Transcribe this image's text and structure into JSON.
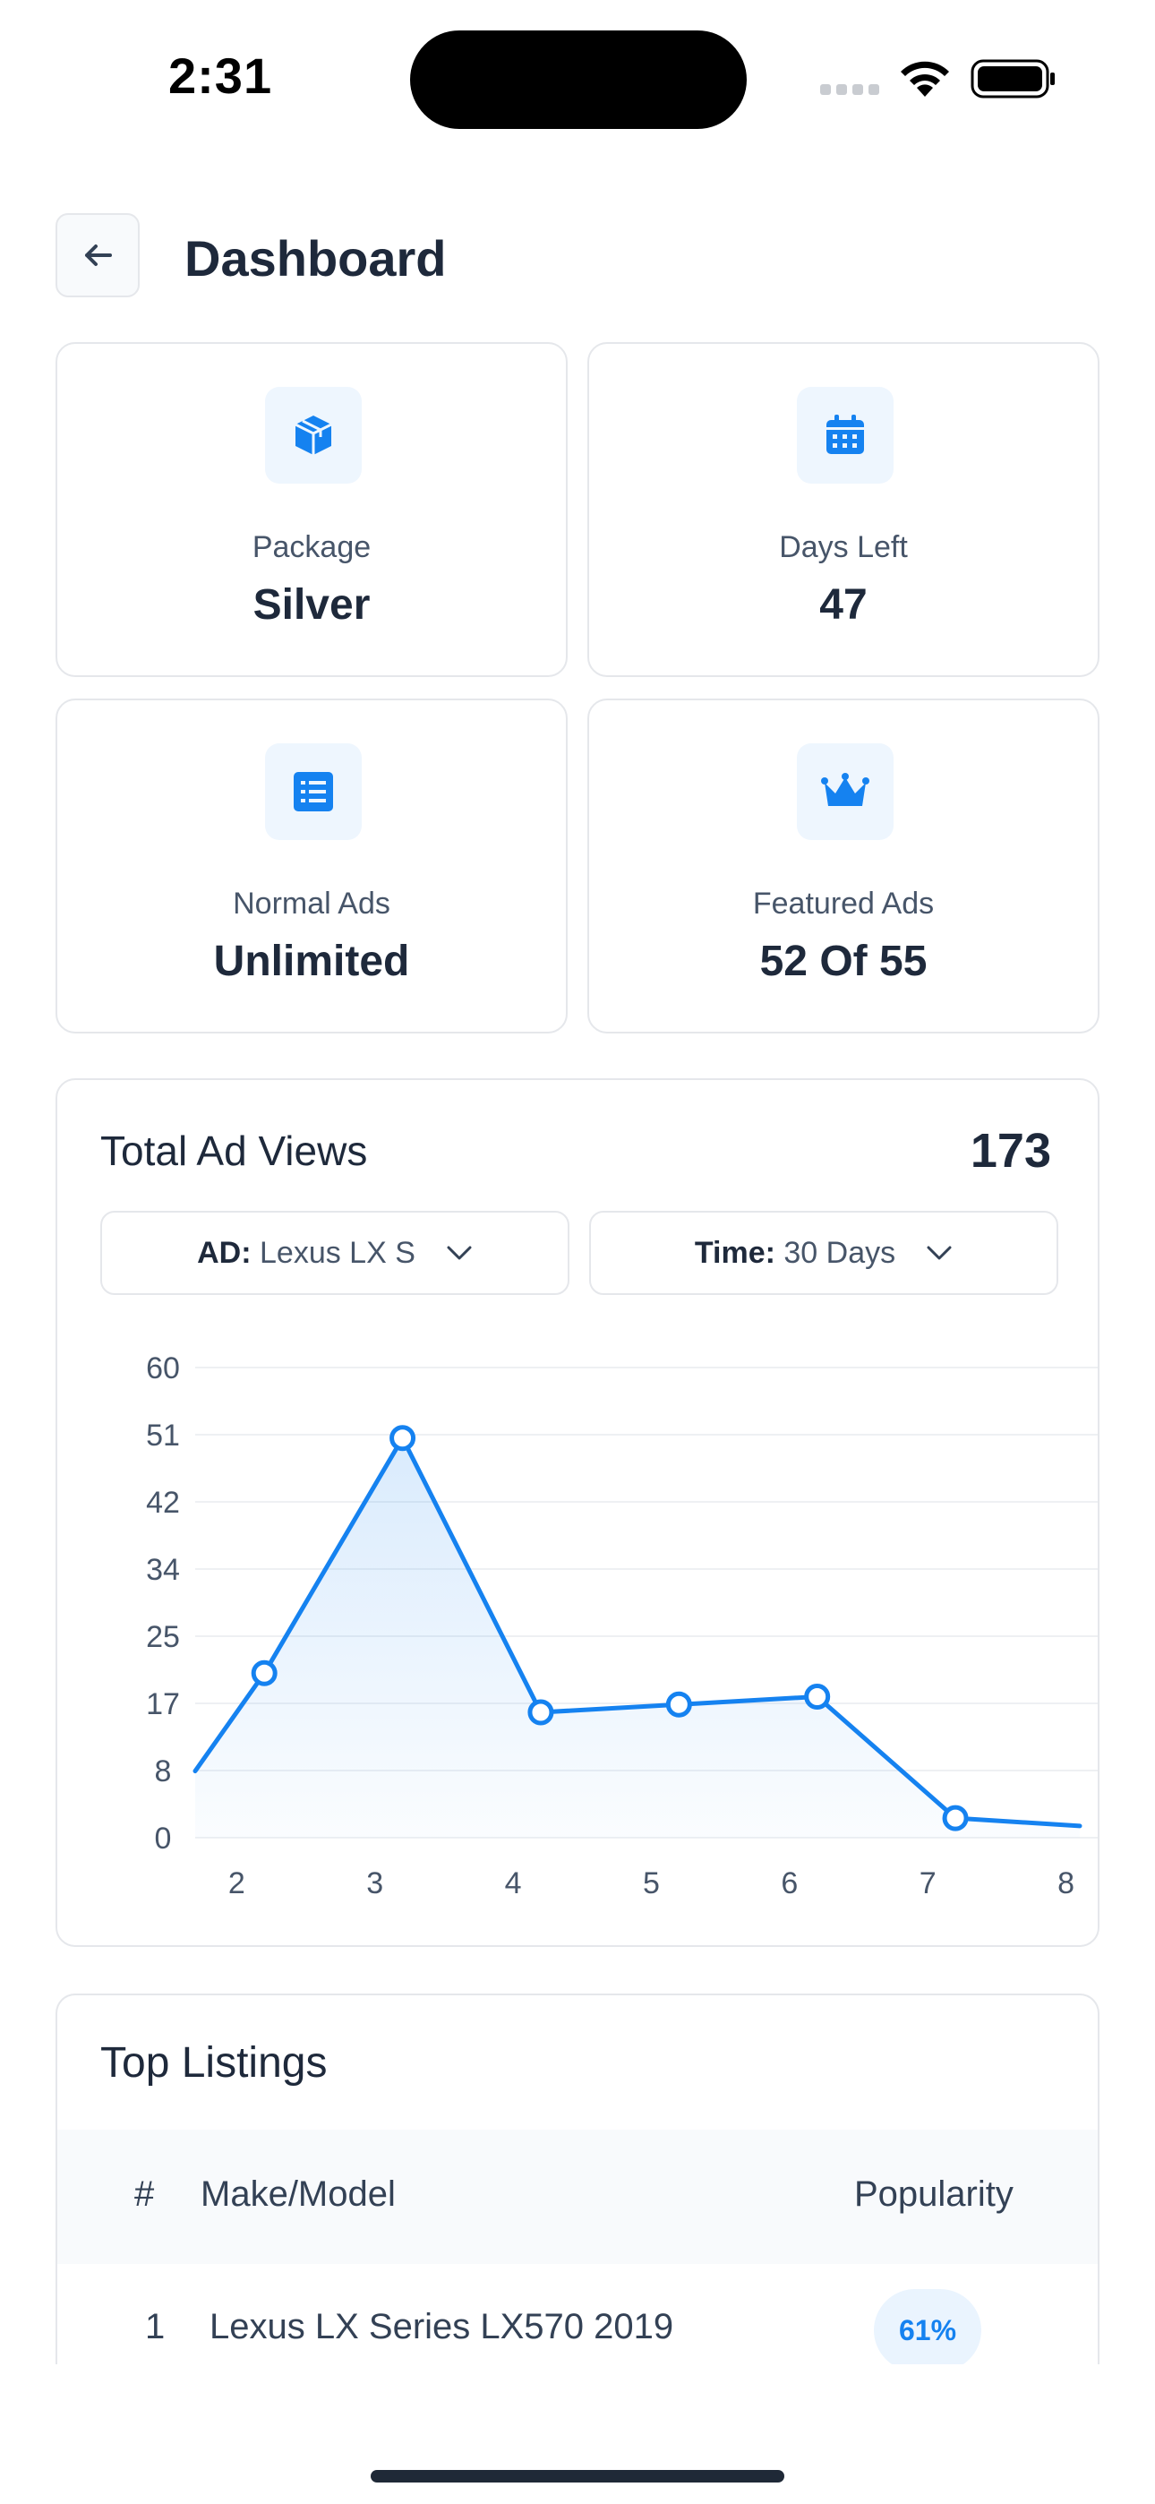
{
  "status_bar": {
    "time": "2:31"
  },
  "header": {
    "back_icon": "arrow-left-icon",
    "title": "Dashboard"
  },
  "stats": [
    {
      "icon": "package-icon",
      "label": "Package",
      "value": "Silver"
    },
    {
      "icon": "calendar-icon",
      "label": "Days Left",
      "value": "47"
    },
    {
      "icon": "list-icon",
      "label": "Normal Ads",
      "value": "Unlimited"
    },
    {
      "icon": "crown-icon",
      "label": "Featured Ads",
      "value": "52 Of 55"
    }
  ],
  "views": {
    "title": "Total Ad Views",
    "total": "173",
    "ad_filter": {
      "key": "AD:",
      "value": "Lexus LX S"
    },
    "time_filter": {
      "key": "Time:",
      "value": "30 Days"
    }
  },
  "chart_data": {
    "type": "area",
    "x": [
      1.7,
      2.2,
      3.2,
      4.2,
      5.2,
      6.2,
      7.2,
      8.1
    ],
    "values": [
      8.5,
      21,
      51,
      16,
      17,
      18,
      2.5,
      1.5
    ],
    "marked_points": [
      1,
      2,
      3,
      4,
      5,
      6
    ],
    "x_ticks": [
      "2",
      "3",
      "4",
      "5",
      "6",
      "7",
      "8"
    ],
    "y_ticks": [
      "0",
      "8",
      "17",
      "25",
      "34",
      "42",
      "51",
      "60"
    ],
    "ylim": [
      0,
      60
    ],
    "xlim": [
      1.7,
      8.1
    ],
    "grid": true,
    "color": "#1582f0"
  },
  "listings": {
    "title": "Top Listings",
    "columns": {
      "num": "#",
      "model": "Make/Model",
      "popularity": "Popularity"
    },
    "rows": [
      {
        "num": "1",
        "model": "Lexus LX Series LX570 2019",
        "popularity": "61%"
      }
    ]
  },
  "colors": {
    "accent": "#1582f0",
    "icon_bg": "#eef6fe",
    "border": "#e5e7eb",
    "text_dark": "#1e293b",
    "text_muted": "#475569"
  }
}
